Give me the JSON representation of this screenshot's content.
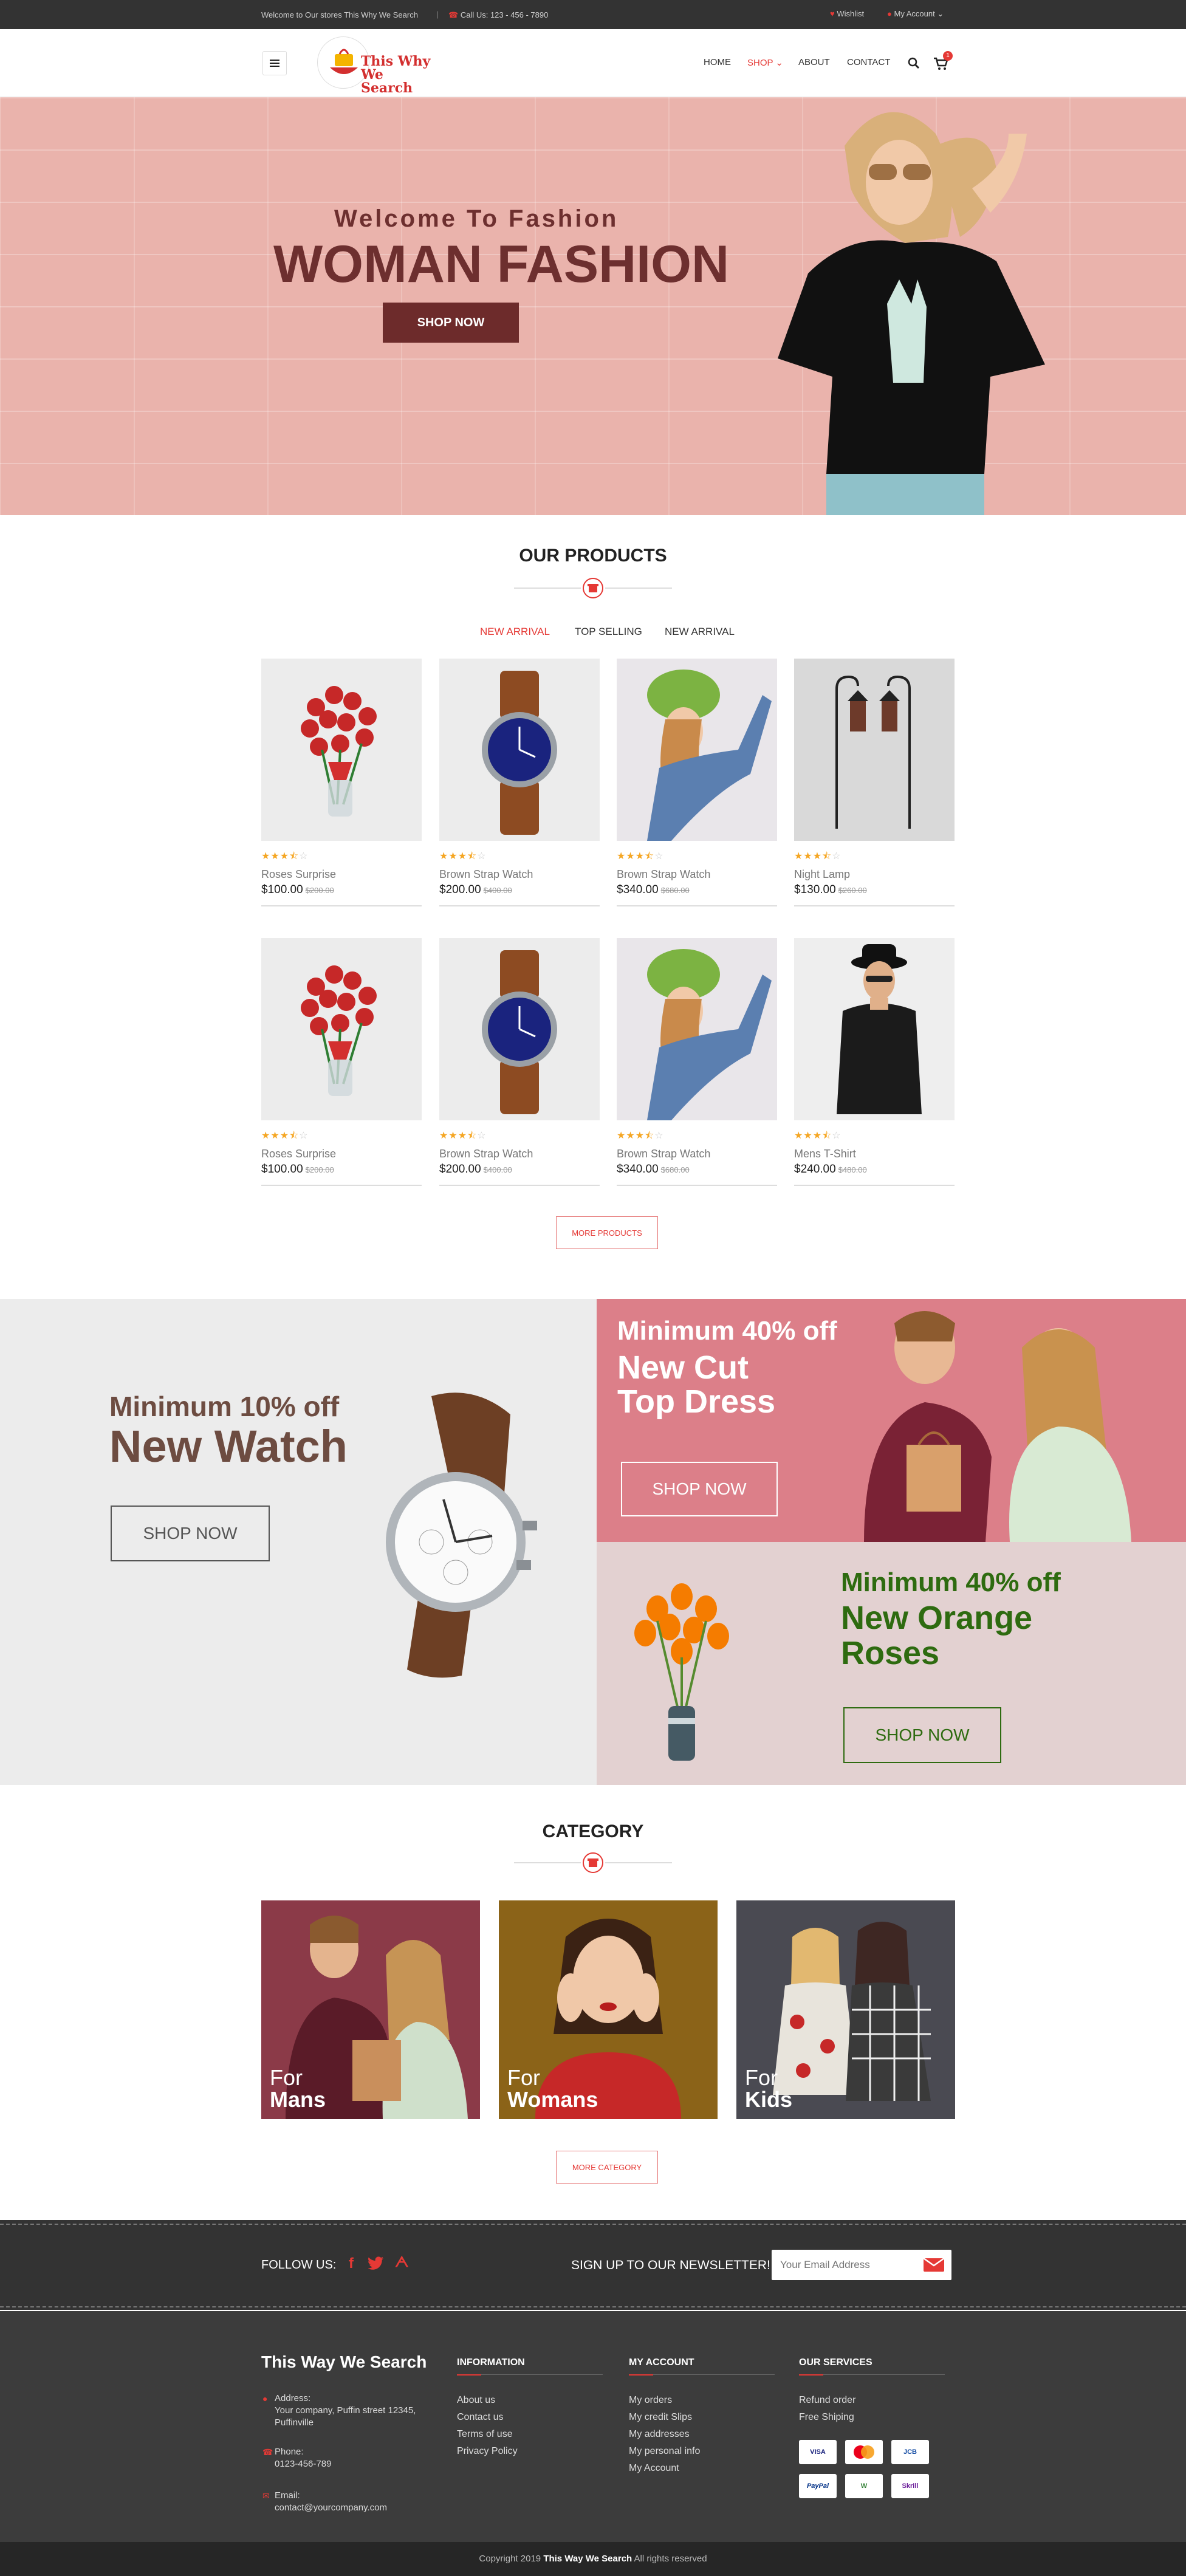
{
  "topbar": {
    "welcome": "Welcome to Our stores This Why We Search",
    "separator": "|",
    "call": "Call Us: 123 - 456 - 7890",
    "wishlist": "Wishlist",
    "account": "My Account"
  },
  "header": {
    "logo_line1": "This Why",
    "logo_line2": "We Search",
    "nav": [
      "HOME",
      "SHOP",
      "ABOUT",
      "CONTACT"
    ],
    "cart_count": "1"
  },
  "hero": {
    "subtitle": "Welcome To Fashion",
    "title": "WOMAN FASHION",
    "button": "SHOP NOW"
  },
  "products": {
    "title": "OUR PRODUCTS",
    "tabs": [
      "NEW ARRIVAL",
      "TOP SELLING",
      "NEW ARRIVAL"
    ],
    "active_tab": "NEW ARRIVAL",
    "rating": "3.5 of 5",
    "items": [
      {
        "name": "Roses Surprise",
        "price": "$100.00",
        "old": "$200.00"
      },
      {
        "name": "Brown Strap Watch",
        "price": "$200.00",
        "old": "$400.00"
      },
      {
        "name": "Brown Strap Watch",
        "price": "$340.00",
        "old": "$680.00"
      },
      {
        "name": "Night Lamp",
        "price": "$130.00",
        "old": "$260.00"
      },
      {
        "name": "Roses Surprise",
        "price": "$100.00",
        "old": "$200.00"
      },
      {
        "name": "Brown Strap Watch",
        "price": "$200.00",
        "old": "$400.00"
      },
      {
        "name": "Brown Strap Watch",
        "price": "$340.00",
        "old": "$680.00"
      },
      {
        "name": "Mens T-Shirt",
        "price": "$240.00",
        "old": "$480.00"
      }
    ],
    "more_button": "MORE PRODUCTS"
  },
  "promos": {
    "watch": {
      "line1": "Minimum 10% off",
      "line2": "New Watch",
      "button": "SHOP NOW"
    },
    "dress": {
      "line1": "Minimum 40% off",
      "line2": "New Cut",
      "line3": "Top Dress",
      "button": "SHOP NOW"
    },
    "roses": {
      "line1": "Minimum 40% off",
      "line2": "New Orange",
      "line3": "Roses",
      "button": "SHOP NOW"
    }
  },
  "category": {
    "title": "CATEGORY",
    "items": [
      {
        "for": "For",
        "label": "Mans"
      },
      {
        "for": "For",
        "label": "Womans"
      },
      {
        "for": "For",
        "label": "Kids"
      }
    ],
    "more_button": "MORE CATEGORY"
  },
  "newsletter": {
    "follow": "FOLLOW US:",
    "signup": "SIGN UP TO OUR NEWSLETTER!",
    "placeholder": "Your Email Address"
  },
  "footer": {
    "brand": "This Way We Search",
    "address_label": "Address:",
    "address": "Your company, Puffin street 12345, Puffinville",
    "phone_label": "Phone:",
    "phone": "0123-456-789",
    "email_label": "Email:",
    "email": "contact@yourcompany.com",
    "information": {
      "title": "INFORMATION",
      "links": [
        "About us",
        "Contact us",
        "Terms of use",
        "Privacy Policy"
      ]
    },
    "account": {
      "title": "MY ACCOUNT",
      "links": [
        "My  orders",
        "My credit Slips",
        "My addresses",
        "My personal info",
        "My  Account"
      ]
    },
    "services": {
      "title": "OUR SERVICES",
      "links": [
        "Refund  order",
        "Free Shiping"
      ]
    },
    "payments": [
      "VISA",
      "MC",
      "JCB",
      "PayPal",
      "W",
      "Skrill"
    ]
  },
  "copyright": {
    "prefix": "Copyright 2019",
    "brand": "This Way We Search",
    "suffix": "All rights reserved"
  },
  "colors": {
    "accent": "#e53935",
    "maroon": "#6d2b2b",
    "dark": "#333333"
  }
}
